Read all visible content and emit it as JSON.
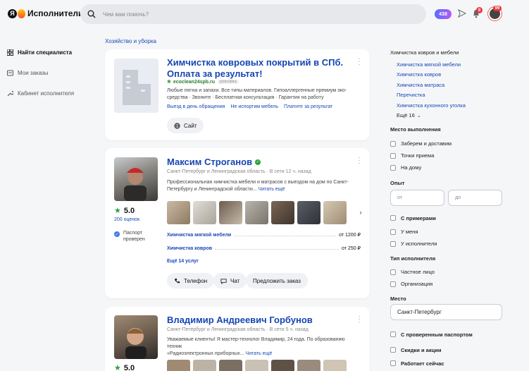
{
  "header": {
    "brand": "Исполнители",
    "ya": "Я",
    "search_placeholder": "Чем вам помочь?",
    "plus_count": "438",
    "notif_count": "8",
    "avatar_count": "99"
  },
  "sidebar": {
    "items": [
      {
        "label": "Найти специалиста"
      },
      {
        "label": "Мои заказы"
      },
      {
        "label": "Кабинет исполнителя"
      }
    ]
  },
  "breadcrumb": "Хозяйство и уборка",
  "ad": {
    "title1": "Химчистка ковровых покрытий в СПб.",
    "title2": "Оплата за результат!",
    "domain": "ecoclean24spb.ru",
    "tag": "реклама",
    "desc1": "Любые пятна и запахи. Все типы материалов. Гипоаллергенные премиум эко-",
    "desc2": "средства · Звоните · Бесплатная консультация · Гарантия на работу",
    "link1": "Выезд в день обращения",
    "link2": "Не испортим мебель",
    "link3": "Платите за результат",
    "site_button": "Сайт"
  },
  "card1": {
    "name": "Максим Строганов",
    "region": "Санкт-Петербург и Ленинградская область",
    "online": "В сети 12 ч. назад",
    "desc1": "Профессиональная химчистка мебели и матрасов с выездом на дом по Санкт-",
    "desc2": "Петербургу и Ленинградской области...",
    "more": "Читать ещё",
    "rating": "5.0",
    "reviews": "200 оценок",
    "passport1": "Паспорт",
    "passport2": "проверен",
    "services": [
      {
        "name": "Химчистка мягкой мебели",
        "price": "от 1200 ₽"
      },
      {
        "name": "Химчистка ковров",
        "price": "от 250 ₽"
      }
    ],
    "more_services": "Ещё 14 услуг",
    "phone": "Телефон",
    "chat": "Чат",
    "offer": "Предложить заказ"
  },
  "card2": {
    "name": "Владимир Андреевич Горбунов",
    "region": "Санкт-Петербург и Ленинградская область",
    "online": "В сети 5 ч. назад",
    "desc1": "Уважаемые клиенты! Я мастер-технолог Владимир, 24 года. По образованию техник",
    "desc2": "«Радиоэлектронных приборных...",
    "more": "Читать ещё",
    "rating": "5.0"
  },
  "filters": {
    "category_title": "Химчистка ковров и мебели",
    "categories": [
      "Химчистка мягкой мебели",
      "Химчистка ковров",
      "Химчистка матраса",
      "Перечистка",
      "Химчистка кухонного уголка"
    ],
    "more": "Ещё 16",
    "place_title": "Место выполнения",
    "places": [
      "Заберем и доставим",
      "Точки приема",
      "На дому"
    ],
    "exp_title": "Опыт",
    "from": "от",
    "to": "до",
    "with_examples": "С примерами",
    "examples": [
      "У меня",
      "У исполнителя"
    ],
    "type_title": "Тип исполнителя",
    "types": [
      "Частное лицо",
      "Организация"
    ],
    "location_title": "Место",
    "location_value": "Санкт-Петербург",
    "passport": "С проверенным паспортом",
    "discounts": "Скидки и акции",
    "works_now": "Работает сейчас"
  }
}
